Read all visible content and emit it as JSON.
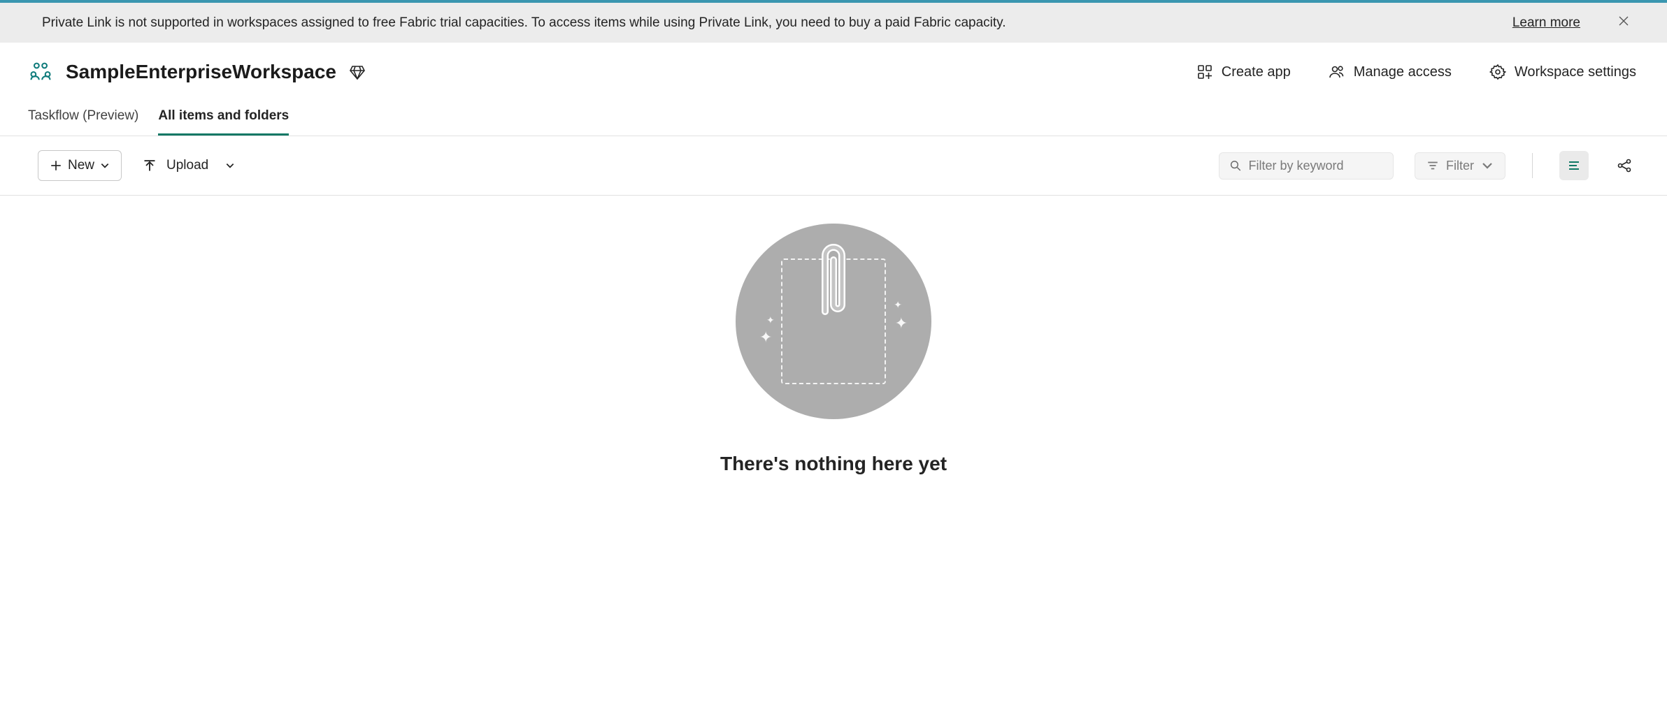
{
  "notification": {
    "message": "Private Link is not supported in workspaces assigned to free Fabric trial capacities. To access items while using Private Link, you need to buy a paid Fabric capacity.",
    "learn_more": "Learn more"
  },
  "workspace": {
    "title": "SampleEnterpriseWorkspace"
  },
  "header_actions": {
    "create_app": "Create app",
    "manage_access": "Manage access",
    "workspace_settings": "Workspace settings"
  },
  "tabs": {
    "taskflow": "Taskflow (Preview)",
    "all_items": "All items and folders"
  },
  "toolbar": {
    "new_label": "New",
    "upload_label": "Upload",
    "filter_placeholder": "Filter by keyword",
    "filter_button": "Filter"
  },
  "empty_state": {
    "title": "There's nothing here yet"
  }
}
